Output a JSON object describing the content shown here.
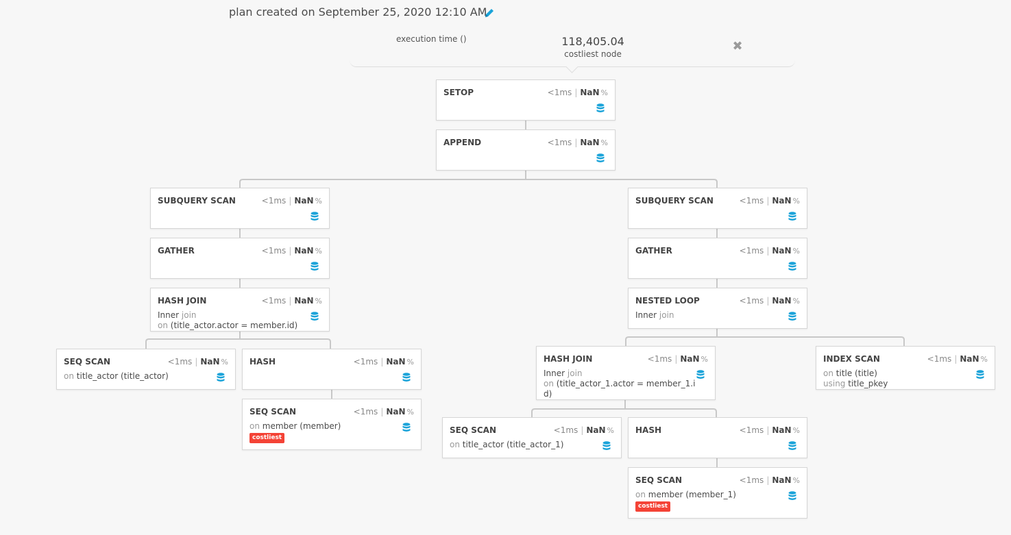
{
  "header": {
    "title": "plan created on September 25, 2020 12:10 AM",
    "edit_icon": "pencil-icon"
  },
  "summary": {
    "execution_time_label": "execution time ()",
    "costliest_value": "118,405.04",
    "costliest_label": "costliest node",
    "close_icon": "close-icon"
  },
  "colors": {
    "accent": "#1aa3d9",
    "costliest_badge": "#f44336",
    "connector": "#c8c8c8"
  },
  "nodes": {
    "setop": {
      "title": "SETOP",
      "time": "<1ms",
      "pct": "NaN",
      "pct_unit": "%"
    },
    "append": {
      "title": "APPEND",
      "time": "<1ms",
      "pct": "NaN",
      "pct_unit": "%"
    },
    "subquery_scan_left": {
      "title": "SUBQUERY SCAN",
      "time": "<1ms",
      "pct": "NaN",
      "pct_unit": "%"
    },
    "gather_left": {
      "title": "GATHER",
      "time": "<1ms",
      "pct": "NaN",
      "pct_unit": "%"
    },
    "hash_join_left": {
      "title": "HASH JOIN",
      "time": "<1ms",
      "pct": "NaN",
      "pct_unit": "%",
      "join_type": "Inner",
      "join_word": "join",
      "on_word": "on",
      "condition": "(title_actor.actor = member.id)"
    },
    "seq_scan_title_actor": {
      "title": "SEQ SCAN",
      "time": "<1ms",
      "pct": "NaN",
      "pct_unit": "%",
      "on_word": "on",
      "relation": "title_actor (title_actor)"
    },
    "hash_left": {
      "title": "HASH",
      "time": "<1ms",
      "pct": "NaN",
      "pct_unit": "%"
    },
    "seq_scan_member": {
      "title": "SEQ SCAN",
      "time": "<1ms",
      "pct": "NaN",
      "pct_unit": "%",
      "on_word": "on",
      "relation": "member (member)",
      "badge": "costliest"
    },
    "subquery_scan_right": {
      "title": "SUBQUERY SCAN",
      "time": "<1ms",
      "pct": "NaN",
      "pct_unit": "%"
    },
    "gather_right": {
      "title": "GATHER",
      "time": "<1ms",
      "pct": "NaN",
      "pct_unit": "%"
    },
    "nested_loop": {
      "title": "NESTED LOOP",
      "time": "<1ms",
      "pct": "NaN",
      "pct_unit": "%",
      "join_type": "Inner",
      "join_word": "join"
    },
    "hash_join_right": {
      "title": "HASH JOIN",
      "time": "<1ms",
      "pct": "NaN",
      "pct_unit": "%",
      "join_type": "Inner",
      "join_word": "join",
      "on_word": "on",
      "condition_line1": "(title_actor_1.actor = member_1.i",
      "condition_line2": "d)"
    },
    "index_scan": {
      "title": "INDEX SCAN",
      "time": "<1ms",
      "pct": "NaN",
      "pct_unit": "%",
      "on_word": "on",
      "relation": "title (title)",
      "using_word": "using",
      "index": "title_pkey"
    },
    "seq_scan_title_actor_1": {
      "title": "SEQ SCAN",
      "time": "<1ms",
      "pct": "NaN",
      "pct_unit": "%",
      "on_word": "on",
      "relation": "title_actor (title_actor_1)"
    },
    "hash_right": {
      "title": "HASH",
      "time": "<1ms",
      "pct": "NaN",
      "pct_unit": "%"
    },
    "seq_scan_member_1": {
      "title": "SEQ SCAN",
      "time": "<1ms",
      "pct": "NaN",
      "pct_unit": "%",
      "on_word": "on",
      "relation": "member (member_1)",
      "badge": "costliest"
    }
  }
}
